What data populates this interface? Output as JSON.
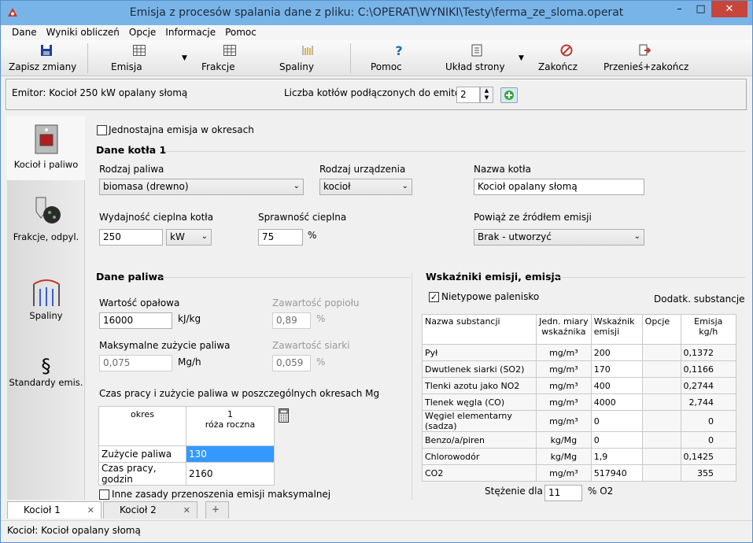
{
  "window": {
    "title": "Emisja z procesów spalania   dane z pliku: C:\\OPERAT\\WYNIKI\\Testy\\ferma_ze_sloma.operat",
    "minimize": "–",
    "maximize": "□",
    "close": "✕"
  },
  "menu": [
    "Dane",
    "Wyniki obliczeń",
    "Opcje",
    "Informacje",
    "Pomoc"
  ],
  "toolbar": {
    "save": "Zapisz zmiany",
    "emisja": "Emisja",
    "frakcje": "Frakcje",
    "spaliny": "Spaliny",
    "pomoc": "Pomoc",
    "uklad": "Układ strony",
    "zakoncz": "Zakończ",
    "przenies": "Przenieś+zakończ"
  },
  "emitter": {
    "label": "Emitor: Kocioł 250 kW opalany słomą",
    "boiler_count_label": "Liczba kotłów podłączonych do emitora",
    "boiler_count": "2"
  },
  "sidebar": [
    {
      "label": "Kocioł i paliwo"
    },
    {
      "label": "Frakcje, odpyl."
    },
    {
      "label": "Spaliny"
    },
    {
      "label": "Standardy emis.",
      "glyph": "§"
    }
  ],
  "uniform_emission_label": "Jednostajna emisja w okresach",
  "boiler": {
    "section_title": "Dane kotła 1",
    "fuel_type_label": "Rodzaj paliwa",
    "fuel_type": "biomasa (drewno)",
    "device_type_label": "Rodzaj urządzenia",
    "device_type": "kocioł",
    "name_label": "Nazwa kotła",
    "name": "Kocioł opalany słomą",
    "heat_output_label": "Wydajność cieplna kotła",
    "heat_output": "250",
    "heat_unit": "kW",
    "efficiency_label": "Sprawność cieplna",
    "efficiency": "75",
    "efficiency_unit": "%",
    "link_label": "Powiąż ze źródłem emisji",
    "link_value": "Brak - utworzyć"
  },
  "fuel": {
    "section_title": "Dane paliwa",
    "calorific_label": "Wartość opałowa",
    "calorific": "16000",
    "calorific_unit": "kJ/kg",
    "ash_label": "Zawartość popiołu",
    "ash": "0,89",
    "ash_unit": "%",
    "max_use_label": "Maksymalne zużycie paliwa",
    "max_use": "0,075",
    "max_use_unit": "Mg/h",
    "sulfur_label": "Zawartość siarki",
    "sulfur": "0,059",
    "sulfur_unit": "%",
    "periods_label": "Czas pracy i zużycie paliwa w poszczególnych okresach Mg",
    "period_header": "okres",
    "period_col_num": "1",
    "period_col_name": "róża roczna",
    "rows": [
      {
        "label": "Zużycie paliwa",
        "value": "130"
      },
      {
        "label": "Czas pracy, godzin",
        "value": "2160"
      }
    ],
    "other_rules_label": "Inne zasady przenoszenia emisji maksymalnej"
  },
  "emissions": {
    "section_title": "Wskaźniki emisji, emisja",
    "atypical_label": "Nietypowe palenisko",
    "extra_substances": "Dodatk. substancje",
    "headers": [
      "Nazwa substancji",
      "Jedn. miary wskaźnika",
      "Wskaźnik emisji",
      "Opcje",
      "Emisja kg/h"
    ],
    "rows": [
      {
        "name": "Pył",
        "unit": "mg/m³",
        "factor": "200",
        "option": "",
        "emission": "0,1372"
      },
      {
        "name": "Dwutlenek siarki (SO2)",
        "unit": "mg/m³",
        "factor": "170",
        "option": "",
        "emission": "0,1166"
      },
      {
        "name": "Tlenki azotu jako NO2",
        "unit": "mg/m³",
        "factor": "400",
        "option": "",
        "emission": "0,2744"
      },
      {
        "name": "Tlenek węgla (CO)",
        "unit": "mg/m³",
        "factor": "4000",
        "option": "",
        "emission": "2,744"
      },
      {
        "name": "Węgiel elementarny (sadza)",
        "unit": "mg/m³",
        "factor": "0",
        "option": "",
        "emission": "0"
      },
      {
        "name": "Benzo/a/piren",
        "unit": "kg/Mg",
        "factor": "0",
        "option": "",
        "emission": "0"
      },
      {
        "name": "Chlorowodór",
        "unit": "kg/Mg",
        "factor": "1,9",
        "option": "",
        "emission": "0,1425"
      },
      {
        "name": "CO2",
        "unit": "mg/m³",
        "factor": "517940",
        "option": "",
        "emission": "355"
      }
    ],
    "o2_label": "Stężenie dla",
    "o2_value": "11",
    "o2_unit": "% O2"
  },
  "tabs": [
    {
      "label": "Kocioł 1"
    },
    {
      "label": "Kocioł 2"
    }
  ],
  "status": "Kocioł: Kocioł opalany słomą",
  "colors": {
    "title_bar": "#79b4e8",
    "close": "#c7453b",
    "selected_cell": "#3399ff"
  }
}
